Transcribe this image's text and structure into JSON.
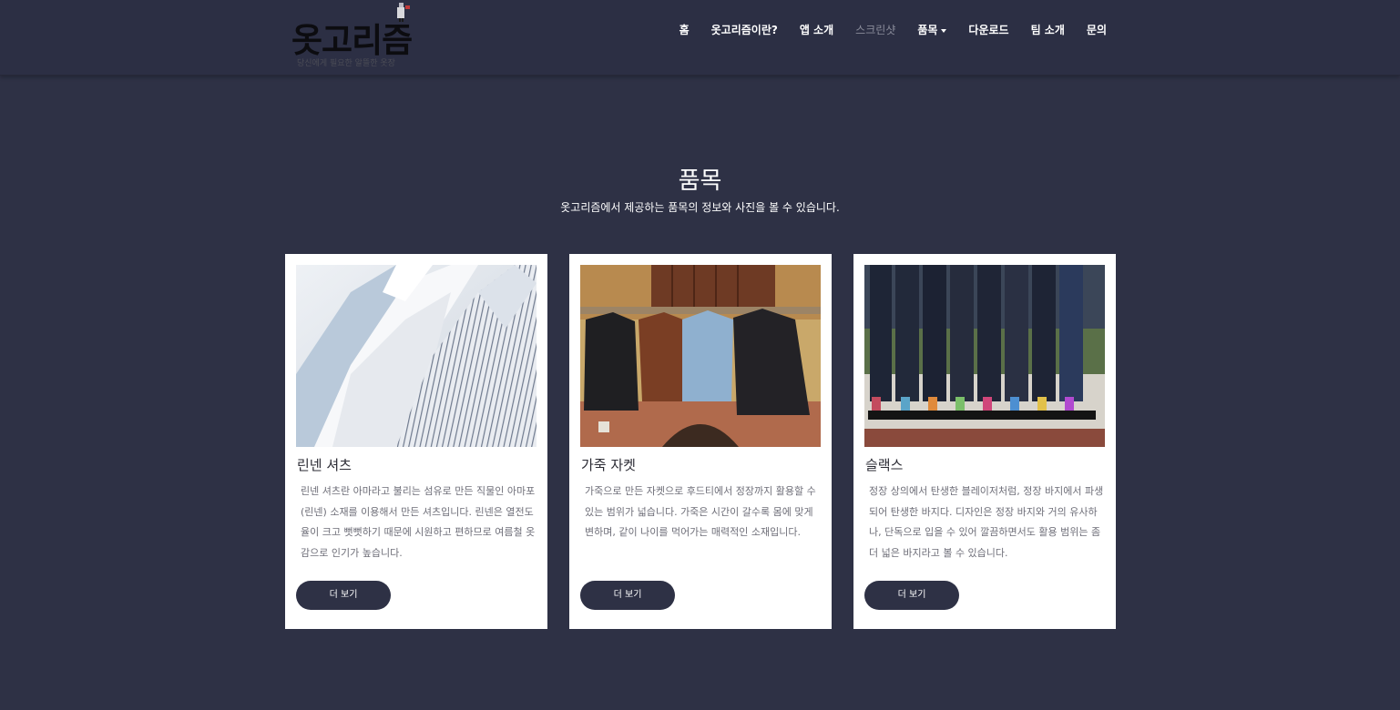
{
  "brand": {
    "title": "옷고리즘",
    "tagline": "당신에게 필요한 알뜰한 옷장"
  },
  "nav": {
    "items": [
      {
        "label": "홈"
      },
      {
        "label": "옷고리즘이란?"
      },
      {
        "label": "앱 소개"
      },
      {
        "label": "스크린샷"
      },
      {
        "label": "품목"
      },
      {
        "label": "다운로드"
      },
      {
        "label": "팀 소개"
      },
      {
        "label": "문의"
      }
    ]
  },
  "section": {
    "title": "품목",
    "subtitle": "옷고리즘에서 제공하는 품목의 정보와 사진을 볼 수 있습니다."
  },
  "cards": [
    {
      "title": "린넨 셔츠",
      "text": "린넨 셔츠란 아마라고 불리는 섬유로 만든 직물인 아마포(린넨) 소재를 이용해서 만든 셔츠입니다. 린넨은 열전도율이 크고 뻣뻣하기 때문에 시원하고 편하므로 여름철 옷감으로 인기가 높습니다.",
      "button": "더 보기"
    },
    {
      "title": "가죽 자켓",
      "text": "가죽으로 만든 자켓으로 후드티에서 정장까지 활용할 수 있는 범위가 넓습니다. 가죽은 시간이 갈수록 몸에 맞게 변하며, 같이 나이를 먹어가는 매력적인 소재입니다.",
      "button": "더 보기"
    },
    {
      "title": "슬랙스",
      "text": "정장 상의에서 탄생한 블레이저처럼, 정장 바지에서 파생되어 탄생한 바지다. 디자인은 정장 바지와 거의 유사하나, 단독으로 입을 수 있어 깔끔하면서도 활용 범위는 좀 더 넓은 바지라고 볼 수 있습니다.",
      "button": "더 보기"
    }
  ],
  "colors": {
    "background": "#2e3145",
    "navbar": "#2c2f44",
    "card": "#ffffff",
    "button": "#2e3145"
  }
}
